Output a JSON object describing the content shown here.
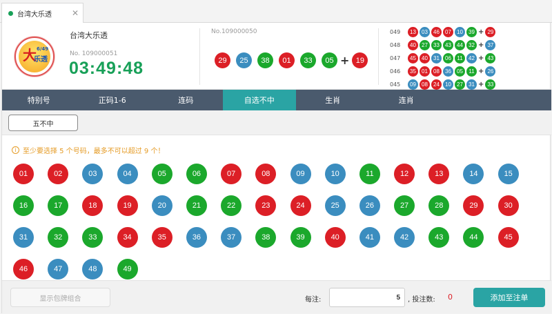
{
  "tab": {
    "title": "台湾大乐透",
    "close": "✕"
  },
  "logo": {
    "big": "大",
    "small": "乐透",
    "badge": "6/49"
  },
  "lottery": {
    "name": "台湾大乐透",
    "current_issue": "No. 109000051",
    "countdown": "03:49:48"
  },
  "last_draw": {
    "issue": "No.109000050",
    "balls": [
      {
        "n": "29",
        "c": "red"
      },
      {
        "n": "25",
        "c": "blue"
      },
      {
        "n": "38",
        "c": "green"
      },
      {
        "n": "01",
        "c": "red"
      },
      {
        "n": "33",
        "c": "green"
      },
      {
        "n": "05",
        "c": "green"
      }
    ],
    "special": {
      "n": "19",
      "c": "red"
    }
  },
  "history": [
    {
      "issue": "049",
      "balls": [
        {
          "n": "13",
          "c": "red"
        },
        {
          "n": "03",
          "c": "blue"
        },
        {
          "n": "46",
          "c": "red"
        },
        {
          "n": "07",
          "c": "red"
        },
        {
          "n": "10",
          "c": "blue"
        },
        {
          "n": "39",
          "c": "green"
        }
      ],
      "special": {
        "n": "29",
        "c": "red"
      }
    },
    {
      "issue": "048",
      "balls": [
        {
          "n": "40",
          "c": "red"
        },
        {
          "n": "27",
          "c": "green"
        },
        {
          "n": "33",
          "c": "green"
        },
        {
          "n": "43",
          "c": "green"
        },
        {
          "n": "44",
          "c": "green"
        },
        {
          "n": "32",
          "c": "green"
        }
      ],
      "special": {
        "n": "37",
        "c": "blue"
      }
    },
    {
      "issue": "047",
      "balls": [
        {
          "n": "45",
          "c": "red"
        },
        {
          "n": "40",
          "c": "red"
        },
        {
          "n": "31",
          "c": "blue"
        },
        {
          "n": "06",
          "c": "green"
        },
        {
          "n": "11",
          "c": "green"
        },
        {
          "n": "42",
          "c": "blue"
        }
      ],
      "special": {
        "n": "43",
        "c": "green"
      }
    },
    {
      "issue": "046",
      "balls": [
        {
          "n": "35",
          "c": "red"
        },
        {
          "n": "01",
          "c": "red"
        },
        {
          "n": "08",
          "c": "red"
        },
        {
          "n": "36",
          "c": "blue"
        },
        {
          "n": "05",
          "c": "green"
        },
        {
          "n": "11",
          "c": "green"
        }
      ],
      "special": {
        "n": "26",
        "c": "blue"
      }
    },
    {
      "issue": "045",
      "balls": [
        {
          "n": "09",
          "c": "blue"
        },
        {
          "n": "08",
          "c": "red"
        },
        {
          "n": "24",
          "c": "red"
        },
        {
          "n": "10",
          "c": "blue"
        },
        {
          "n": "27",
          "c": "green"
        },
        {
          "n": "31",
          "c": "blue"
        }
      ],
      "special": {
        "n": "33",
        "c": "green"
      }
    }
  ],
  "nav": {
    "items": [
      "特别号",
      "正码1-6",
      "连码",
      "自选不中",
      "生肖",
      "连肖"
    ],
    "active_index": 3
  },
  "sub_filter": {
    "label": "五不中"
  },
  "hint": {
    "icon": "info-icon",
    "text": "至少要选择 5 个号码，最多不可以超过 9 个！"
  },
  "balls": [
    {
      "n": "01",
      "c": "red"
    },
    {
      "n": "02",
      "c": "red"
    },
    {
      "n": "03",
      "c": "blue"
    },
    {
      "n": "04",
      "c": "blue"
    },
    {
      "n": "05",
      "c": "green"
    },
    {
      "n": "06",
      "c": "green"
    },
    {
      "n": "07",
      "c": "red"
    },
    {
      "n": "08",
      "c": "red"
    },
    {
      "n": "09",
      "c": "blue"
    },
    {
      "n": "10",
      "c": "blue"
    },
    {
      "n": "11",
      "c": "green"
    },
    {
      "n": "12",
      "c": "red"
    },
    {
      "n": "13",
      "c": "red"
    },
    {
      "n": "14",
      "c": "blue"
    },
    {
      "n": "15",
      "c": "blue"
    },
    {
      "n": "16",
      "c": "green"
    },
    {
      "n": "17",
      "c": "green"
    },
    {
      "n": "18",
      "c": "red"
    },
    {
      "n": "19",
      "c": "red"
    },
    {
      "n": "20",
      "c": "blue"
    },
    {
      "n": "21",
      "c": "green"
    },
    {
      "n": "22",
      "c": "green"
    },
    {
      "n": "23",
      "c": "red"
    },
    {
      "n": "24",
      "c": "red"
    },
    {
      "n": "25",
      "c": "blue"
    },
    {
      "n": "26",
      "c": "blue"
    },
    {
      "n": "27",
      "c": "green"
    },
    {
      "n": "28",
      "c": "green"
    },
    {
      "n": "29",
      "c": "red"
    },
    {
      "n": "30",
      "c": "red"
    },
    {
      "n": "31",
      "c": "blue"
    },
    {
      "n": "32",
      "c": "green"
    },
    {
      "n": "33",
      "c": "green"
    },
    {
      "n": "34",
      "c": "red"
    },
    {
      "n": "35",
      "c": "red"
    },
    {
      "n": "36",
      "c": "blue"
    },
    {
      "n": "37",
      "c": "blue"
    },
    {
      "n": "38",
      "c": "green"
    },
    {
      "n": "39",
      "c": "green"
    },
    {
      "n": "40",
      "c": "red"
    },
    {
      "n": "41",
      "c": "blue"
    },
    {
      "n": "42",
      "c": "blue"
    },
    {
      "n": "43",
      "c": "green"
    },
    {
      "n": "44",
      "c": "green"
    },
    {
      "n": "45",
      "c": "red"
    },
    {
      "n": "46",
      "c": "red"
    },
    {
      "n": "47",
      "c": "blue"
    },
    {
      "n": "48",
      "c": "blue"
    },
    {
      "n": "49",
      "c": "green"
    }
  ],
  "footer": {
    "combo_label": "显示包牌组合",
    "per_bet_label": "每注:",
    "per_bet_value": "5",
    "bet_count_label": ", 投注数:",
    "bet_count_value": "0",
    "add_label": "添加至注单"
  },
  "colors": {
    "red": "#dc1f26",
    "blue": "#3b8dbf",
    "green": "#1ba82c",
    "accent": "#2aa4a4",
    "nav": "#4a5a6d"
  }
}
